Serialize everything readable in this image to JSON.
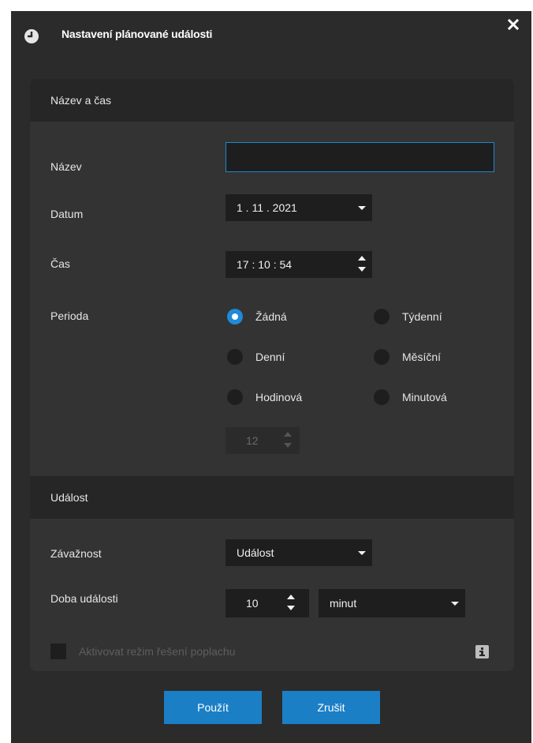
{
  "dialog": {
    "title": "Nastavení plánované události",
    "title_icon": "clock-icon",
    "close_icon": "close-icon"
  },
  "section_name_time": {
    "header": "Název a čas",
    "name_label": "Název",
    "name_value": "",
    "date_label": "Datum",
    "date_value": "1 . 11 . 2021",
    "time_label": "Čas",
    "time_value": "17 : 10 : 54",
    "period_label": "Perioda",
    "period_options": [
      {
        "label": "Žádná",
        "checked": true
      },
      {
        "label": "Týdenní",
        "checked": false
      },
      {
        "label": "Denní",
        "checked": false
      },
      {
        "label": "Měsíční",
        "checked": false
      },
      {
        "label": "Hodinová",
        "checked": false
      },
      {
        "label": "Minutová",
        "checked": false
      }
    ],
    "interval_value": "12"
  },
  "section_event": {
    "header": "Událost",
    "severity_label": "Závažnost",
    "severity_value": "Událost",
    "duration_label": "Doba události",
    "duration_value": "10",
    "duration_unit": "minut",
    "alarm_checkbox_label": "Aktivovat režim řešení poplachu",
    "alarm_checked": false,
    "info_icon": "info-icon"
  },
  "buttons": {
    "apply": "Použít",
    "cancel": "Zrušit"
  },
  "colors": {
    "accent": "#1e8ad8",
    "button": "#1b7fc6",
    "dialog_bg": "#2b2b2b",
    "panel_bg": "#333333",
    "section_header_bg": "#262626",
    "input_bg": "#1e1e1e"
  }
}
